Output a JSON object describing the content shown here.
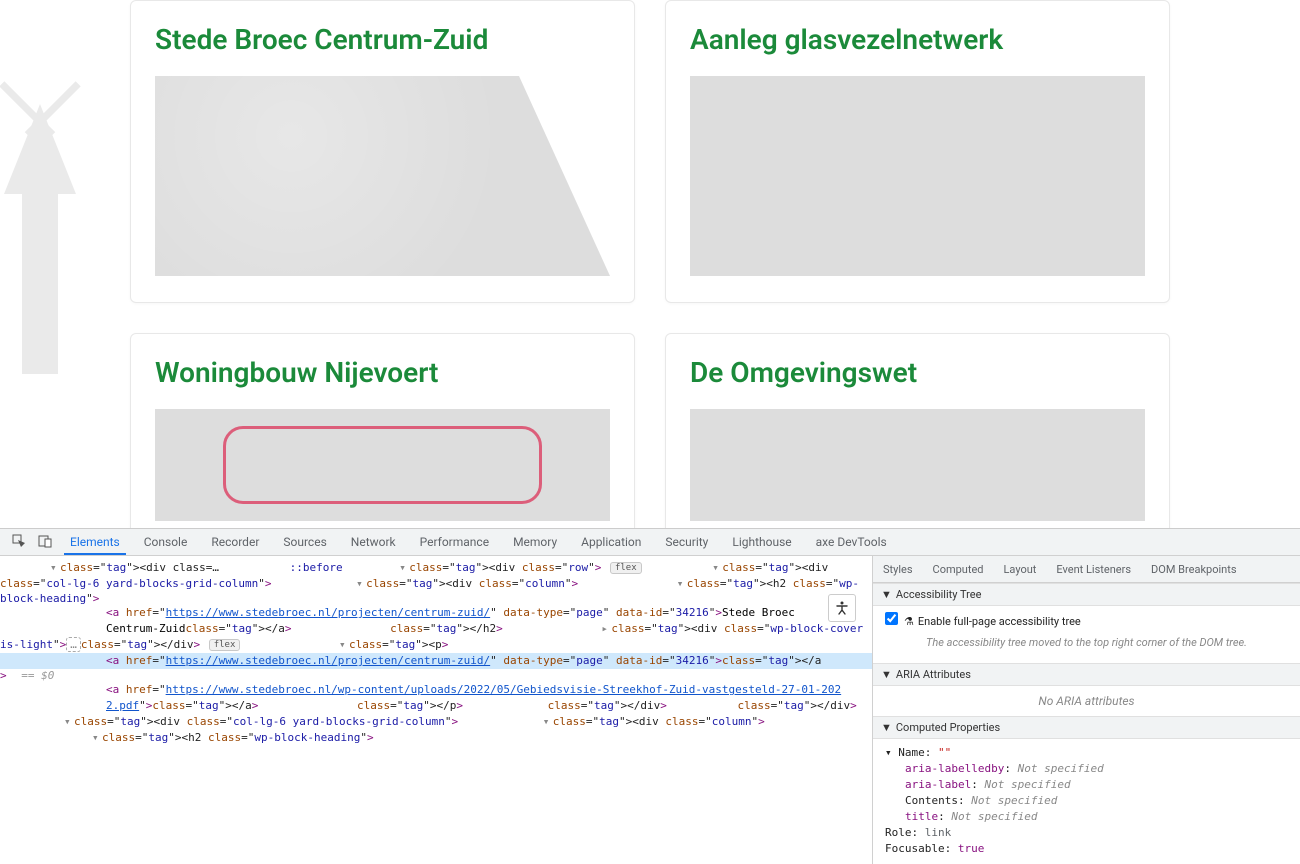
{
  "cards": [
    {
      "title": "Stede Broec Centrum-Zuid"
    },
    {
      "title": "Aanleg glasvezelnetwerk"
    },
    {
      "title": "Woningbouw Nijevoert"
    },
    {
      "title": "De Omgevingswet"
    }
  ],
  "devtools": {
    "main_tabs": [
      "Elements",
      "Console",
      "Recorder",
      "Sources",
      "Network",
      "Performance",
      "Memory",
      "Application",
      "Security",
      "Lighthouse",
      "axe DevTools"
    ],
    "main_active": "Elements",
    "a11y_icon": "♿",
    "dom": {
      "l0_before": "::before",
      "l1_open": "<div class=\"row\">",
      "l1_pill": "flex",
      "l2_open": "<div class=\"col-lg-6 yard-blocks-grid-column\">",
      "l3_open": "<div class=\"column\">",
      "l4_h2_open": "<h2 class=\"wp-block-heading\">",
      "l5_a_pre": "<a href=\"",
      "l5_a_url": "https://www.stedebroec.nl/projecten/centrum-zuid/",
      "l5_a_mid": "\" data-type=\"page\" data-id=\"34216\">",
      "l5_text1": "Stede Broec ",
      "l5_text2": "Centrum-Zuid",
      "l5_a_close": "</a>",
      "l4_h2_close": "</h2>",
      "l4_cover": "<div class=\"wp-block-cover is-light\">",
      "l4_cover_dots": "…",
      "l4_cover_close": "</div>",
      "l4_cover_pill": "flex",
      "l4_p_open": "<p>",
      "l5b_a_pre": "<a href=\"",
      "l5b_a_url": "https://www.stedebroec.nl/projecten/centrum-zuid/",
      "l5b_a_mid": "\" data-type=\"page\" data-id=\"34216\">",
      "l5b_a_close": "</a>",
      "l5b_sel": "== $0",
      "l5c_a_pre": "<a href=\"",
      "l5c_a_url1": "https://www.stedebroec.nl/wp-content/uploads/2022/05/Gebiedsvisie-Streekhof-Zuid-vastgesteld-27-01-202",
      "l5c_a_url2": "2.pdf",
      "l5c_a_mid": "\">",
      "l5c_a_close": "</a>",
      "l4_p_close": "</p>",
      "l3_close": "</div>",
      "l2_close": "</div>",
      "l2b_open": "<div class=\"col-lg-6 yard-blocks-grid-column\">",
      "l3b_open": "<div class=\"column\">",
      "l4b_h2_open": "<h2 class=\"wp-block-heading\">"
    },
    "right": {
      "sub_tabs": [
        "Styles",
        "Computed",
        "Layout",
        "Event Listeners",
        "DOM Breakpoints"
      ],
      "a11y_tree_hdr": "Accessibility Tree",
      "a11y_tree_chk_label": "Enable full-page accessibility tree",
      "a11y_tree_msg": "The accessibility tree moved to the top right corner of the DOM tree.",
      "aria_hdr": "ARIA Attributes",
      "aria_msg": "No ARIA attributes",
      "computed_hdr": "Computed Properties",
      "name_lbl": "Name: ",
      "name_val": "\"\"",
      "aria_labelledby_k": "aria-labelledby",
      "aria_label_k": "aria-label",
      "contents_k": "Contents",
      "title_k": "title",
      "not_spec": "Not specified",
      "role_k": "Role: ",
      "role_v": "link",
      "focusable_k": "Focusable: ",
      "focusable_v": "true",
      "url_frag": "\"https://www.stedebroec.nl/projecten/centrum-zuid/\""
    }
  }
}
